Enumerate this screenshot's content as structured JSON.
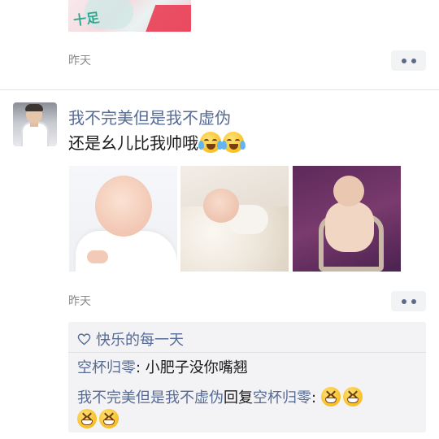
{
  "previous_post": {
    "image_alt_text": "十足",
    "time": "昨天"
  },
  "post": {
    "username": "我不完美但是我不虚伪",
    "text": "还是幺儿比我帅哦",
    "emojis": [
      "loudly-crying-face",
      "loudly-crying-face"
    ],
    "photos": [
      "baby-photo-1",
      "baby-photo-2",
      "baby-photo-3"
    ],
    "time": "昨天"
  },
  "interactions": {
    "likes": {
      "icon": "heart-outline-icon",
      "names": "快乐的每一天"
    },
    "comments": [
      {
        "author": "空杯归零",
        "separator": ": ",
        "text": "小肥子没你嘴翘"
      },
      {
        "author": "我不完美但是我不虚伪",
        "reply_word": "回复",
        "reply_to": "空杯归零",
        "separator": ": ",
        "emojis": [
          "grinning-face",
          "grinning-face",
          "grinning-face",
          "grinning-face"
        ]
      }
    ]
  },
  "colors": {
    "link": "#576b95",
    "text": "#1a1a1a",
    "time": "#8c8c8c",
    "comment_bg": "#f3f3f5"
  }
}
